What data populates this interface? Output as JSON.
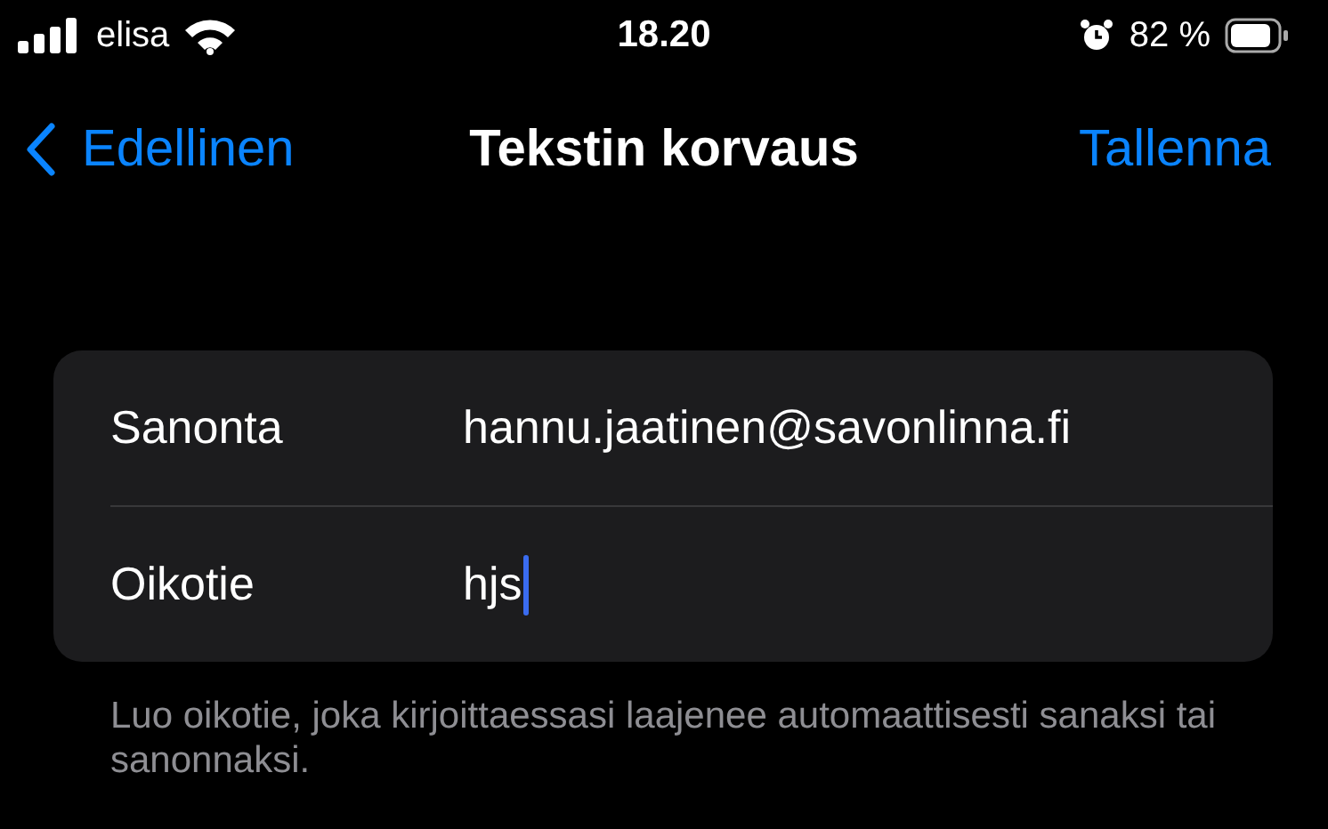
{
  "status_bar": {
    "carrier": "elisa",
    "time": "18.20",
    "battery_percent": "82 %"
  },
  "nav_bar": {
    "back": "Edellinen",
    "title": "Tekstin korvaus",
    "action": "Tallenna"
  },
  "fields": [
    {
      "label": "Sanonta",
      "value": "hannu.jaatinen@savonlinna.fi",
      "focused": false
    },
    {
      "label": "Oikotie",
      "value": "hjs",
      "focused": true
    }
  ],
  "footer": "Luo oikotie, joka kirjoittaessasi laajenee automaattisesti sanaksi tai sanonnaksi."
}
